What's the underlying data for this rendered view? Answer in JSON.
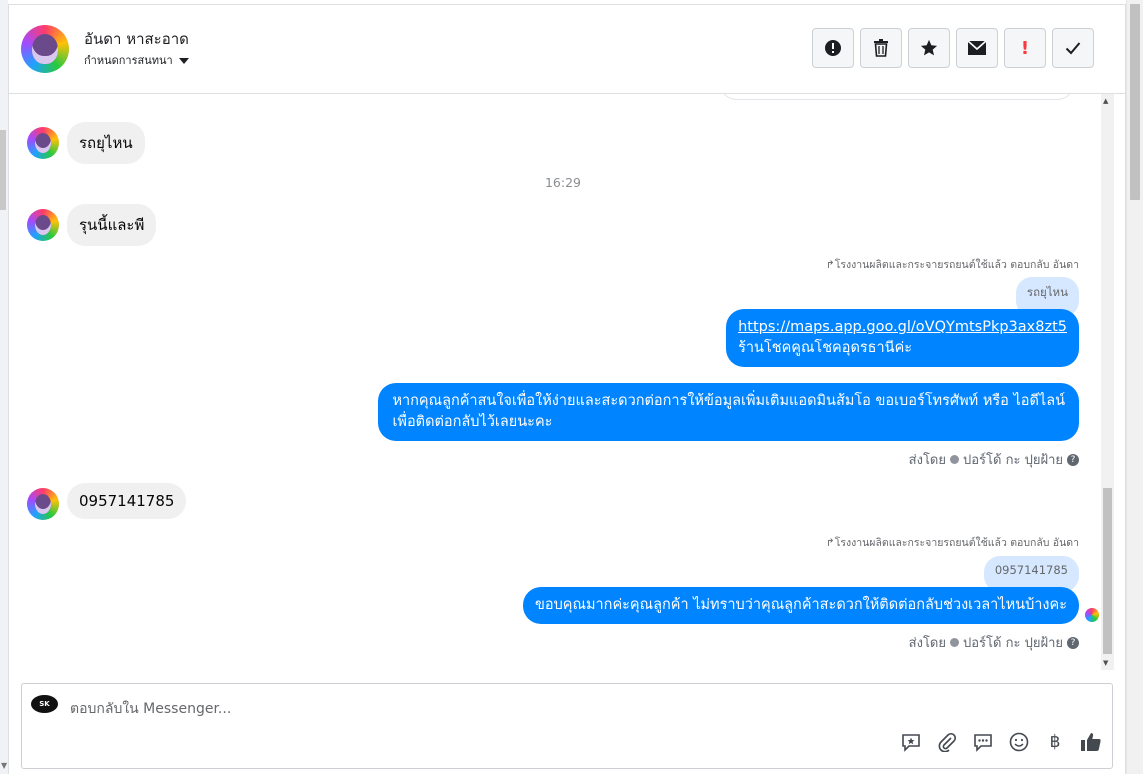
{
  "header": {
    "contact_name": "อันดา หาสะอาด",
    "subtitle": "กำหนดการสนทนา",
    "actions": [
      {
        "name": "report-icon",
        "glyph": "!"
      },
      {
        "name": "trash-icon",
        "glyph": "🗑"
      },
      {
        "name": "star-icon",
        "glyph": "★"
      },
      {
        "name": "mail-icon",
        "glyph": "✉"
      },
      {
        "name": "alert-icon",
        "glyph": "!"
      },
      {
        "name": "check-icon",
        "glyph": "✓"
      }
    ]
  },
  "messages": {
    "m1": "รถยุไหน",
    "time1": "16:29",
    "m2": "รุนนี้และพี",
    "reply1_note": "โรงงานผลิตและกระจายรถยนต์ใช้แล้ว ตอบกลับ อันดา",
    "reply1_quote": "รถยุไหน",
    "reply1_link": "https://maps.app.goo.gl/oVQYmtsPkp3ax8zt5",
    "reply1_text": "ร้านโชคคูณโชคอุดรธานีค่ะ",
    "out2_line1": "หากคุณลูกค้าสนใจเพื่อให้ง่ายและสะดวกต่อการให้ข้อมูลเพิ่มเติมแอดมินส้มโอ ขอเบอร์โทรศัพท์ หรือ ไอดีไลน์",
    "out2_line2": "เพื่อติดต่อกลับไว้เลยนะคะ",
    "sent_by_1": "ส่งโดย",
    "sender_1": "ปอร์โด้ กะ ปุยฝ้าย",
    "m3": "0957141785",
    "reply2_note": "โรงงานผลิตและกระจายรถยนต์ใช้แล้ว ตอบกลับ อันดา",
    "reply2_quote": "0957141785",
    "reply2_text": "ขอบคุณมากค่ะคุณลูกค้า ไม่ทราบว่าคุณลูกค้าสะดวกให้ติดต่อกลับช่วงเวลาไหนบ้างคะ",
    "sent_by_2": "ส่งโดย",
    "sender_2": "ปอร์โด้ กะ ปุยฝ้าย"
  },
  "composer": {
    "placeholder": "ตอบกลับใน Messenger...",
    "tools": [
      "saved-reply-icon",
      "attach-icon",
      "comment-icon",
      "emoji-icon",
      "baht-icon",
      "like-icon"
    ]
  },
  "colors": {
    "outgoing": "#0084ff",
    "incoming": "#f0f0f0",
    "quote": "#d6e8ff"
  }
}
